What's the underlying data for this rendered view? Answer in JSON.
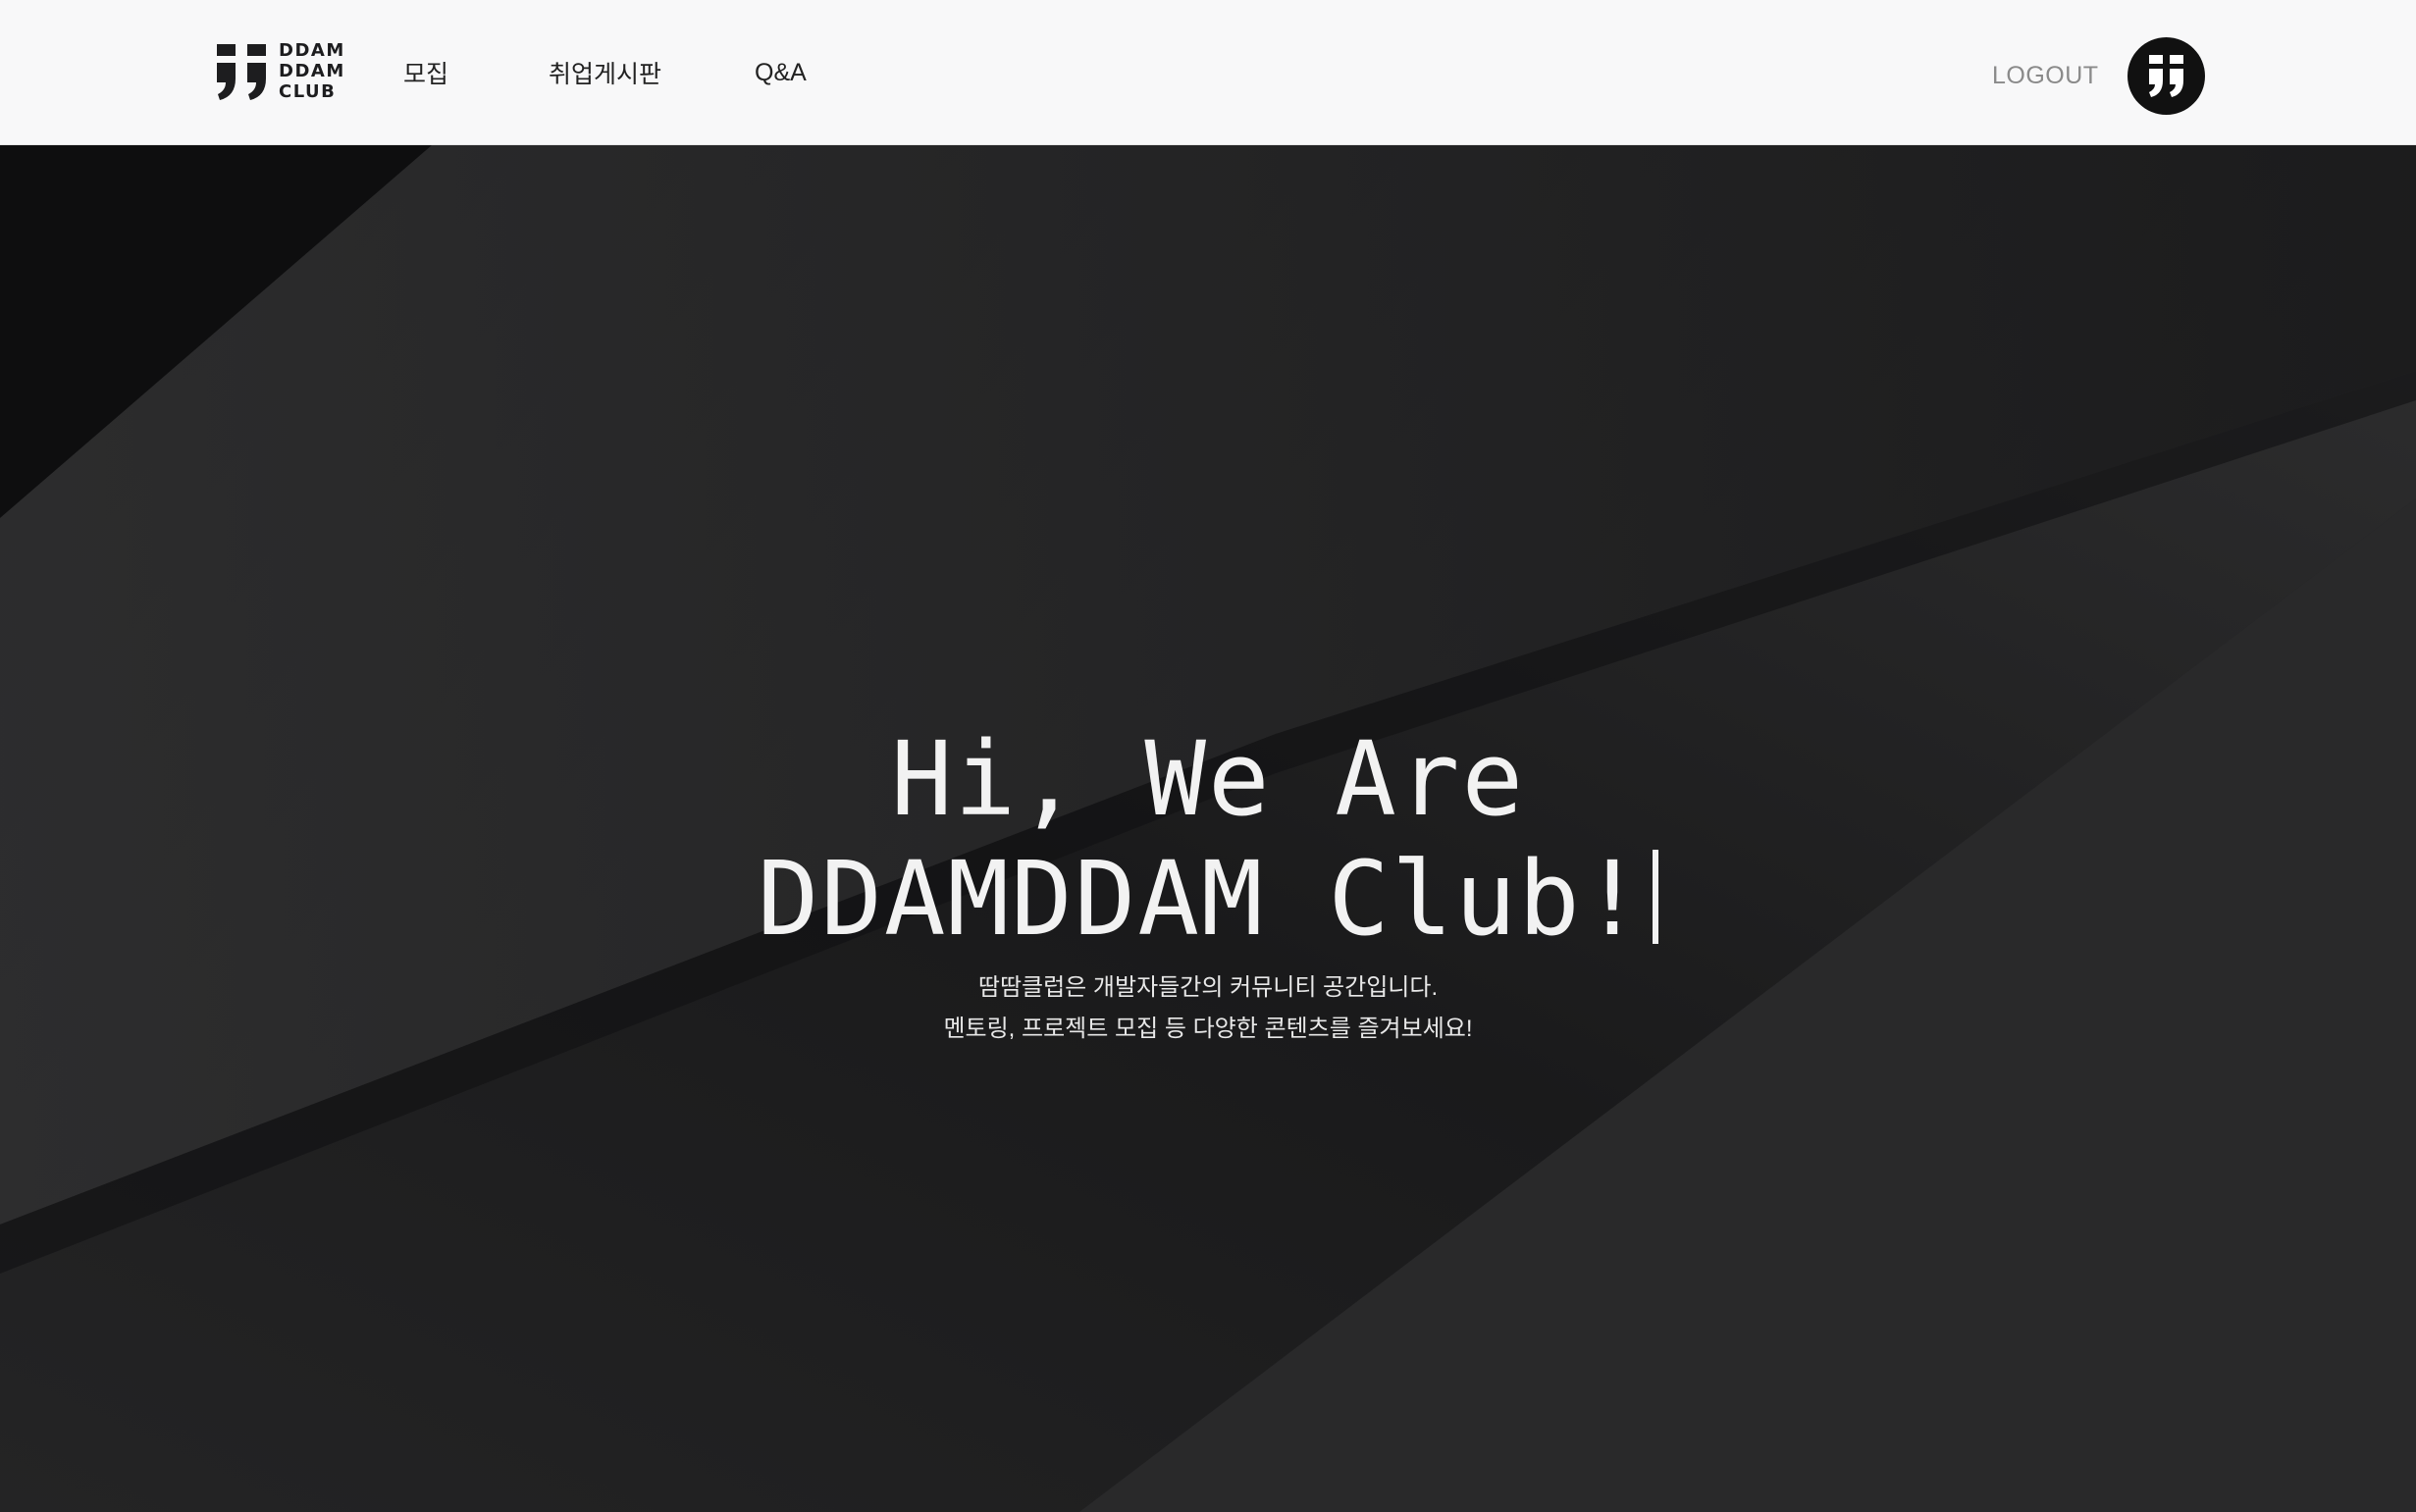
{
  "header": {
    "logo": {
      "line1": "DDAM",
      "line2": "DDAM",
      "line3": "CLUB"
    },
    "nav": {
      "recruit": "모집",
      "jobs": "취업게시판",
      "qna": "Q&A"
    },
    "logout_label": "LOGOUT",
    "avatar_icon": "ddamddam-logo-icon"
  },
  "hero": {
    "title_line1": "Hi, We Are",
    "title_line2": "DDAMDDAM Club!",
    "subtitle_line1": "땀땀클럽은 개발자들간의 커뮤니티 공간입니다.",
    "subtitle_line2": "멘토링, 프로젝트 모집 등 다양한 콘텐츠를 즐겨보세요!"
  },
  "colors": {
    "header_bg": "#f8f8f9",
    "hero_bg": "#1f1f20",
    "hero_text": "#f2f2f2",
    "logout_text": "#8a8a8a",
    "logo_mark": "#1d1d1f"
  }
}
